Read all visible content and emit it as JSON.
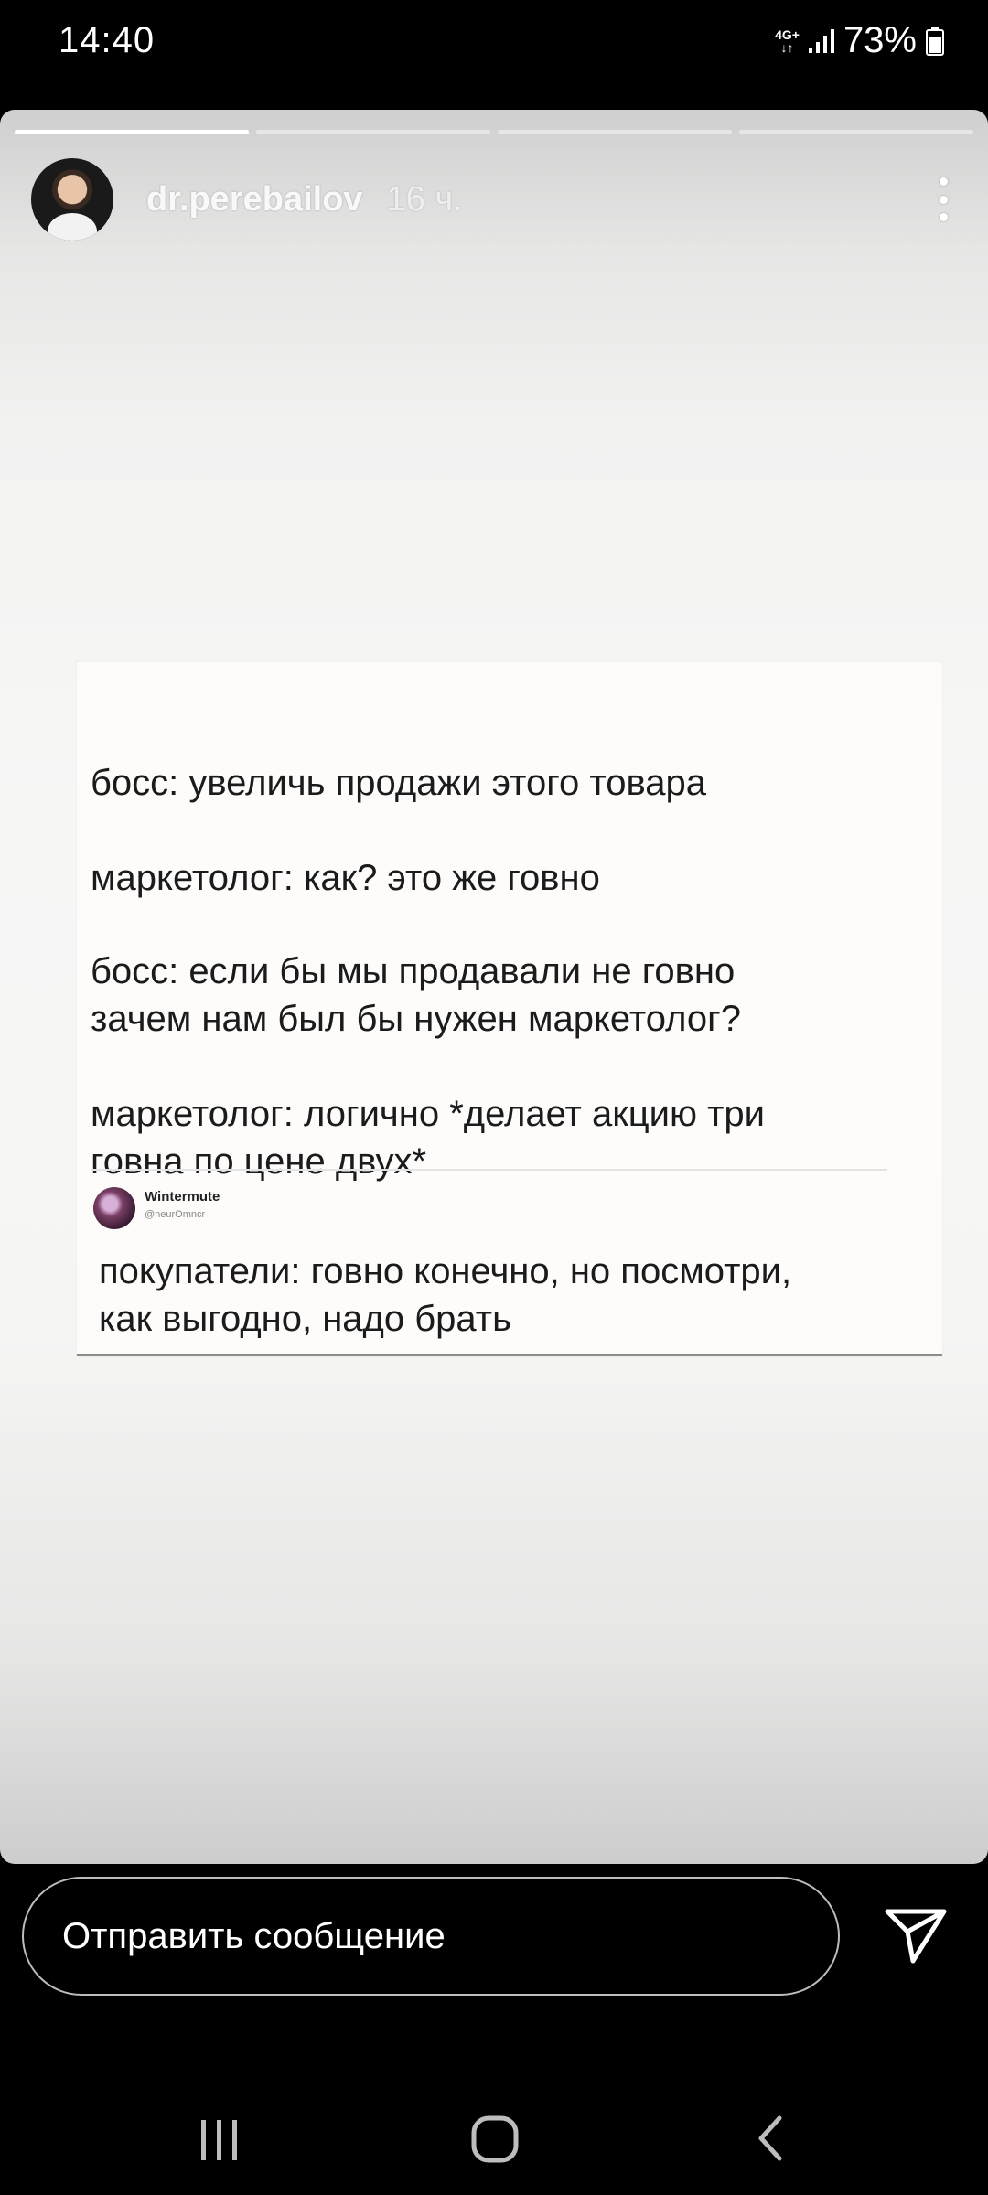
{
  "status_bar": {
    "time": "14:40",
    "network": "4G+",
    "battery": "73%"
  },
  "story": {
    "progress": [
      1,
      0,
      0,
      0
    ],
    "username": "dr.perebailov",
    "time_ago": "16 ч."
  },
  "meme": {
    "lines": [
      "босс: увеличь продажи этого товара",
      "маркетолог: как? это же говно",
      "босс: если бы мы продавали не говно",
      "зачем нам был бы нужен маркетолог?",
      "маркетолог: логично *делает акцию три",
      "говна по цене двух*",
      "покупатели: говно конечно, но посмотри,",
      "как выгодно, надо брать"
    ],
    "tweet_name": "Wintermute",
    "tweet_handle": "@neurOmncr"
  },
  "reply": {
    "placeholder": "Отправить сообщение"
  },
  "icons": {
    "send": "send-icon",
    "more": "more-vertical-icon",
    "nav_recents": "recents-icon",
    "nav_home": "home-icon",
    "nav_back": "back-icon"
  }
}
